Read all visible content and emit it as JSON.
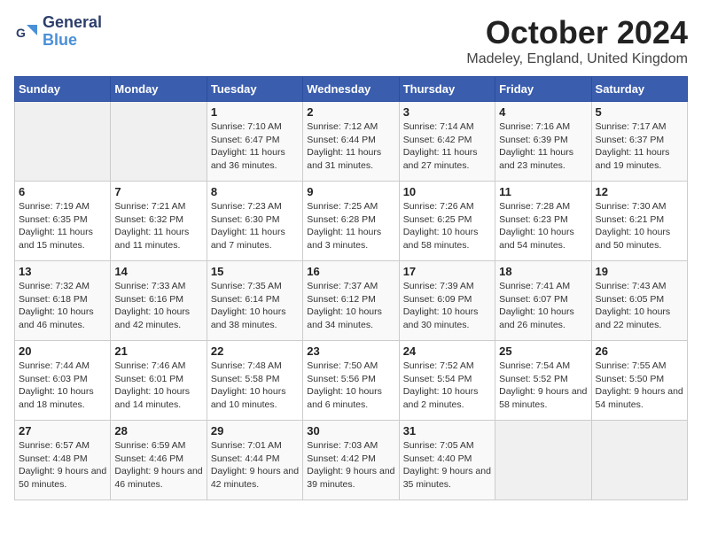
{
  "logo": {
    "line1": "General",
    "line2": "Blue"
  },
  "title": "October 2024",
  "subtitle": "Madeley, England, United Kingdom",
  "days_of_week": [
    "Sunday",
    "Monday",
    "Tuesday",
    "Wednesday",
    "Thursday",
    "Friday",
    "Saturday"
  ],
  "weeks": [
    [
      {
        "day": "",
        "info": ""
      },
      {
        "day": "",
        "info": ""
      },
      {
        "day": "1",
        "info": "Sunrise: 7:10 AM\nSunset: 6:47 PM\nDaylight: 11 hours and 36 minutes."
      },
      {
        "day": "2",
        "info": "Sunrise: 7:12 AM\nSunset: 6:44 PM\nDaylight: 11 hours and 31 minutes."
      },
      {
        "day": "3",
        "info": "Sunrise: 7:14 AM\nSunset: 6:42 PM\nDaylight: 11 hours and 27 minutes."
      },
      {
        "day": "4",
        "info": "Sunrise: 7:16 AM\nSunset: 6:39 PM\nDaylight: 11 hours and 23 minutes."
      },
      {
        "day": "5",
        "info": "Sunrise: 7:17 AM\nSunset: 6:37 PM\nDaylight: 11 hours and 19 minutes."
      }
    ],
    [
      {
        "day": "6",
        "info": "Sunrise: 7:19 AM\nSunset: 6:35 PM\nDaylight: 11 hours and 15 minutes."
      },
      {
        "day": "7",
        "info": "Sunrise: 7:21 AM\nSunset: 6:32 PM\nDaylight: 11 hours and 11 minutes."
      },
      {
        "day": "8",
        "info": "Sunrise: 7:23 AM\nSunset: 6:30 PM\nDaylight: 11 hours and 7 minutes."
      },
      {
        "day": "9",
        "info": "Sunrise: 7:25 AM\nSunset: 6:28 PM\nDaylight: 11 hours and 3 minutes."
      },
      {
        "day": "10",
        "info": "Sunrise: 7:26 AM\nSunset: 6:25 PM\nDaylight: 10 hours and 58 minutes."
      },
      {
        "day": "11",
        "info": "Sunrise: 7:28 AM\nSunset: 6:23 PM\nDaylight: 10 hours and 54 minutes."
      },
      {
        "day": "12",
        "info": "Sunrise: 7:30 AM\nSunset: 6:21 PM\nDaylight: 10 hours and 50 minutes."
      }
    ],
    [
      {
        "day": "13",
        "info": "Sunrise: 7:32 AM\nSunset: 6:18 PM\nDaylight: 10 hours and 46 minutes."
      },
      {
        "day": "14",
        "info": "Sunrise: 7:33 AM\nSunset: 6:16 PM\nDaylight: 10 hours and 42 minutes."
      },
      {
        "day": "15",
        "info": "Sunrise: 7:35 AM\nSunset: 6:14 PM\nDaylight: 10 hours and 38 minutes."
      },
      {
        "day": "16",
        "info": "Sunrise: 7:37 AM\nSunset: 6:12 PM\nDaylight: 10 hours and 34 minutes."
      },
      {
        "day": "17",
        "info": "Sunrise: 7:39 AM\nSunset: 6:09 PM\nDaylight: 10 hours and 30 minutes."
      },
      {
        "day": "18",
        "info": "Sunrise: 7:41 AM\nSunset: 6:07 PM\nDaylight: 10 hours and 26 minutes."
      },
      {
        "day": "19",
        "info": "Sunrise: 7:43 AM\nSunset: 6:05 PM\nDaylight: 10 hours and 22 minutes."
      }
    ],
    [
      {
        "day": "20",
        "info": "Sunrise: 7:44 AM\nSunset: 6:03 PM\nDaylight: 10 hours and 18 minutes."
      },
      {
        "day": "21",
        "info": "Sunrise: 7:46 AM\nSunset: 6:01 PM\nDaylight: 10 hours and 14 minutes."
      },
      {
        "day": "22",
        "info": "Sunrise: 7:48 AM\nSunset: 5:58 PM\nDaylight: 10 hours and 10 minutes."
      },
      {
        "day": "23",
        "info": "Sunrise: 7:50 AM\nSunset: 5:56 PM\nDaylight: 10 hours and 6 minutes."
      },
      {
        "day": "24",
        "info": "Sunrise: 7:52 AM\nSunset: 5:54 PM\nDaylight: 10 hours and 2 minutes."
      },
      {
        "day": "25",
        "info": "Sunrise: 7:54 AM\nSunset: 5:52 PM\nDaylight: 9 hours and 58 minutes."
      },
      {
        "day": "26",
        "info": "Sunrise: 7:55 AM\nSunset: 5:50 PM\nDaylight: 9 hours and 54 minutes."
      }
    ],
    [
      {
        "day": "27",
        "info": "Sunrise: 6:57 AM\nSunset: 4:48 PM\nDaylight: 9 hours and 50 minutes."
      },
      {
        "day": "28",
        "info": "Sunrise: 6:59 AM\nSunset: 4:46 PM\nDaylight: 9 hours and 46 minutes."
      },
      {
        "day": "29",
        "info": "Sunrise: 7:01 AM\nSunset: 4:44 PM\nDaylight: 9 hours and 42 minutes."
      },
      {
        "day": "30",
        "info": "Sunrise: 7:03 AM\nSunset: 4:42 PM\nDaylight: 9 hours and 39 minutes."
      },
      {
        "day": "31",
        "info": "Sunrise: 7:05 AM\nSunset: 4:40 PM\nDaylight: 9 hours and 35 minutes."
      },
      {
        "day": "",
        "info": ""
      },
      {
        "day": "",
        "info": ""
      }
    ]
  ]
}
